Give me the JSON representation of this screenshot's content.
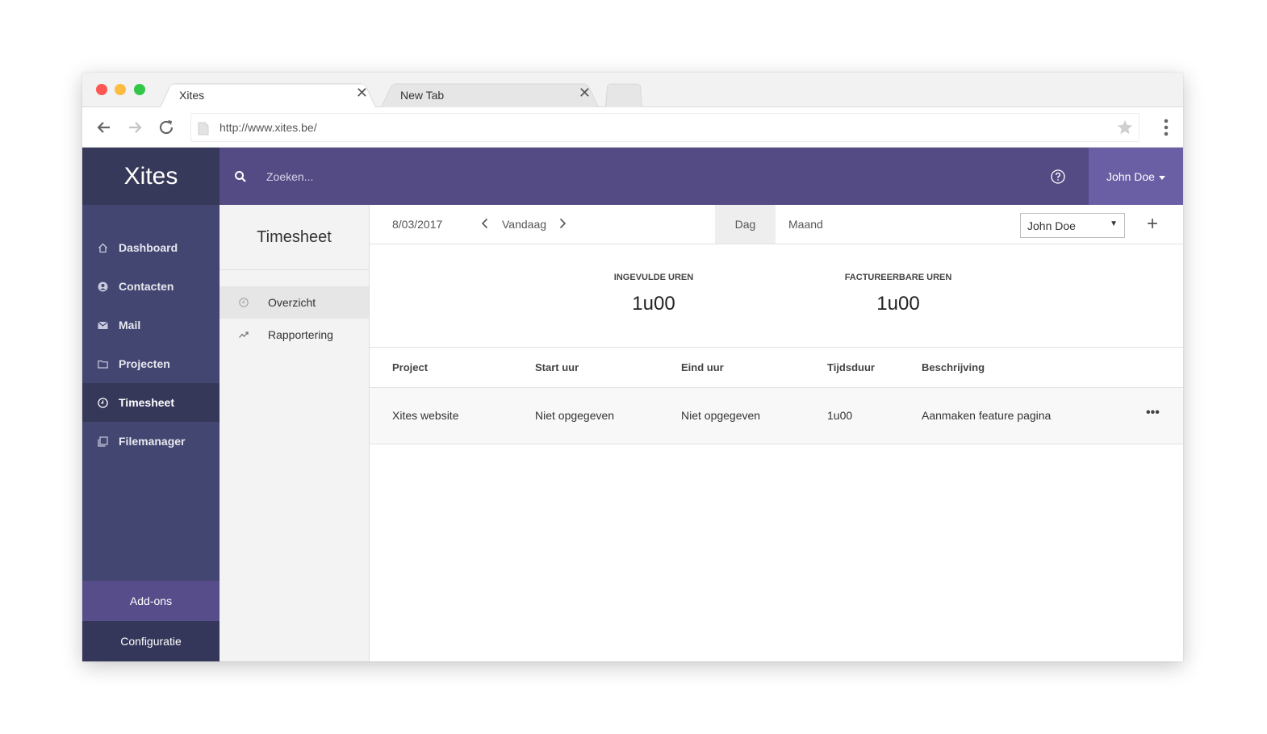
{
  "browser": {
    "tabs": [
      {
        "title": "Xites",
        "close": "✕"
      },
      {
        "title": "New Tab",
        "close": "✕"
      }
    ],
    "url": "http://www.xites.be/"
  },
  "app": {
    "brand": "Xites",
    "search_placeholder": "Zoeken...",
    "user_name": "John Doe",
    "colors": {
      "topbar": "#554b84",
      "sidebar": "#434670",
      "addons": "#574d8a"
    }
  },
  "sidebar": {
    "items": [
      {
        "label": "Dashboard",
        "icon": "home-icon"
      },
      {
        "label": "Contacten",
        "icon": "contact-icon"
      },
      {
        "label": "Mail",
        "icon": "mail-icon"
      },
      {
        "label": "Projecten",
        "icon": "folder-icon"
      },
      {
        "label": "Timesheet",
        "icon": "clock-icon",
        "active": true
      },
      {
        "label": "Filemanager",
        "icon": "files-icon"
      }
    ],
    "addons": "Add-ons",
    "config": "Configuratie"
  },
  "subnav": {
    "title": "Timesheet",
    "items": [
      {
        "label": "Overzicht",
        "icon": "clock-icon",
        "active": true
      },
      {
        "label": "Rapportering",
        "icon": "trend-icon"
      }
    ]
  },
  "toolbar": {
    "date": "8/03/2017",
    "today": "Vandaag",
    "day": "Dag",
    "month": "Maand",
    "user_select": "John Doe",
    "plus": "+"
  },
  "stats": [
    {
      "label": "INGEVULDE UREN",
      "value": "1u00"
    },
    {
      "label": "FACTUREERBARE UREN",
      "value": "1u00"
    }
  ],
  "table": {
    "headers": [
      "Project",
      "Start uur",
      "Eind uur",
      "Tijdsduur",
      "Beschrijving"
    ],
    "rows": [
      [
        "Xites website",
        "Niet opgegeven",
        "Niet opgegeven",
        "1u00",
        "Aanmaken feature pagina"
      ]
    ],
    "more": "•••"
  }
}
